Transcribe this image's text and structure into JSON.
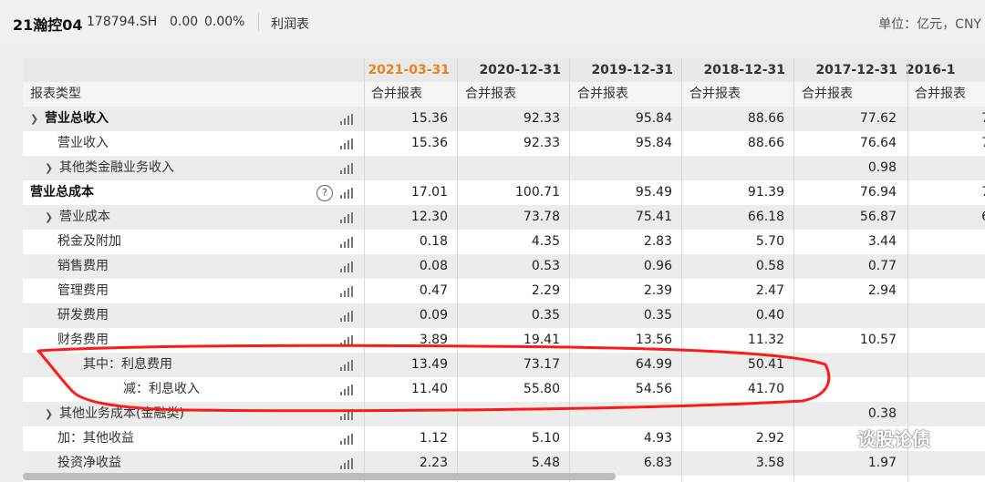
{
  "header": {
    "stock_name": "21瀚控04",
    "stock_code": "178794.SH",
    "price": "0.00",
    "change_pct": "0.00%",
    "report_tab": "利润表",
    "unit": "单位：亿元，CNY"
  },
  "table": {
    "dates": [
      "2021-03-31",
      "2020-12-31",
      "2019-12-31",
      "2018-12-31",
      "2017-12-31",
      "2016-1"
    ],
    "type_label": "报表类型",
    "report_types": [
      "合并报表",
      "合并报表",
      "合并报表",
      "合并报表",
      "合并报表",
      "合并报表"
    ],
    "rows": [
      {
        "label": "营业总收入",
        "values": [
          "15.36",
          "92.33",
          "95.84",
          "88.66",
          "77.62",
          "7"
        ]
      },
      {
        "label": "营业收入",
        "values": [
          "15.36",
          "92.33",
          "95.84",
          "88.66",
          "76.64",
          "7"
        ]
      },
      {
        "label": "其他类金融业务收入",
        "values": [
          "",
          "",
          "",
          "",
          "0.98",
          ""
        ]
      },
      {
        "label": "营业总成本",
        "values": [
          "17.01",
          "100.71",
          "95.49",
          "91.39",
          "76.94",
          "7"
        ]
      },
      {
        "label": "营业成本",
        "values": [
          "12.30",
          "73.78",
          "75.41",
          "66.18",
          "56.87",
          "6"
        ]
      },
      {
        "label": "税金及附加",
        "values": [
          "0.18",
          "4.35",
          "2.83",
          "5.70",
          "3.44",
          ""
        ]
      },
      {
        "label": "销售费用",
        "values": [
          "0.08",
          "0.53",
          "0.96",
          "0.58",
          "0.77",
          ""
        ]
      },
      {
        "label": "管理费用",
        "values": [
          "0.47",
          "2.29",
          "2.39",
          "2.47",
          "2.94",
          ""
        ]
      },
      {
        "label": "研发费用",
        "values": [
          "0.09",
          "0.35",
          "0.35",
          "0.40",
          "",
          ""
        ]
      },
      {
        "label": "财务费用",
        "values": [
          "3.89",
          "19.41",
          "13.56",
          "11.32",
          "10.57",
          ""
        ]
      },
      {
        "label": "其中：利息费用",
        "values": [
          "13.49",
          "73.17",
          "64.99",
          "50.41",
          "",
          ""
        ]
      },
      {
        "label": "减：利息收入",
        "values": [
          "11.40",
          "55.80",
          "54.56",
          "41.70",
          "",
          ""
        ]
      },
      {
        "label": "其他业务成本(金融类)",
        "values": [
          "",
          "",
          "",
          "",
          "0.38",
          ""
        ]
      },
      {
        "label": "加：其他收益",
        "values": [
          "1.12",
          "5.10",
          "4.93",
          "2.92",
          "",
          ""
        ]
      },
      {
        "label": "投资净收益",
        "values": [
          "2.23",
          "5.48",
          "6.83",
          "3.58",
          "1.97",
          ""
        ]
      }
    ]
  },
  "help_glyph": "?",
  "watermark": "谈股论债",
  "colors": {
    "active_date": "#e8821e",
    "annotation": "#ff1a1a"
  }
}
